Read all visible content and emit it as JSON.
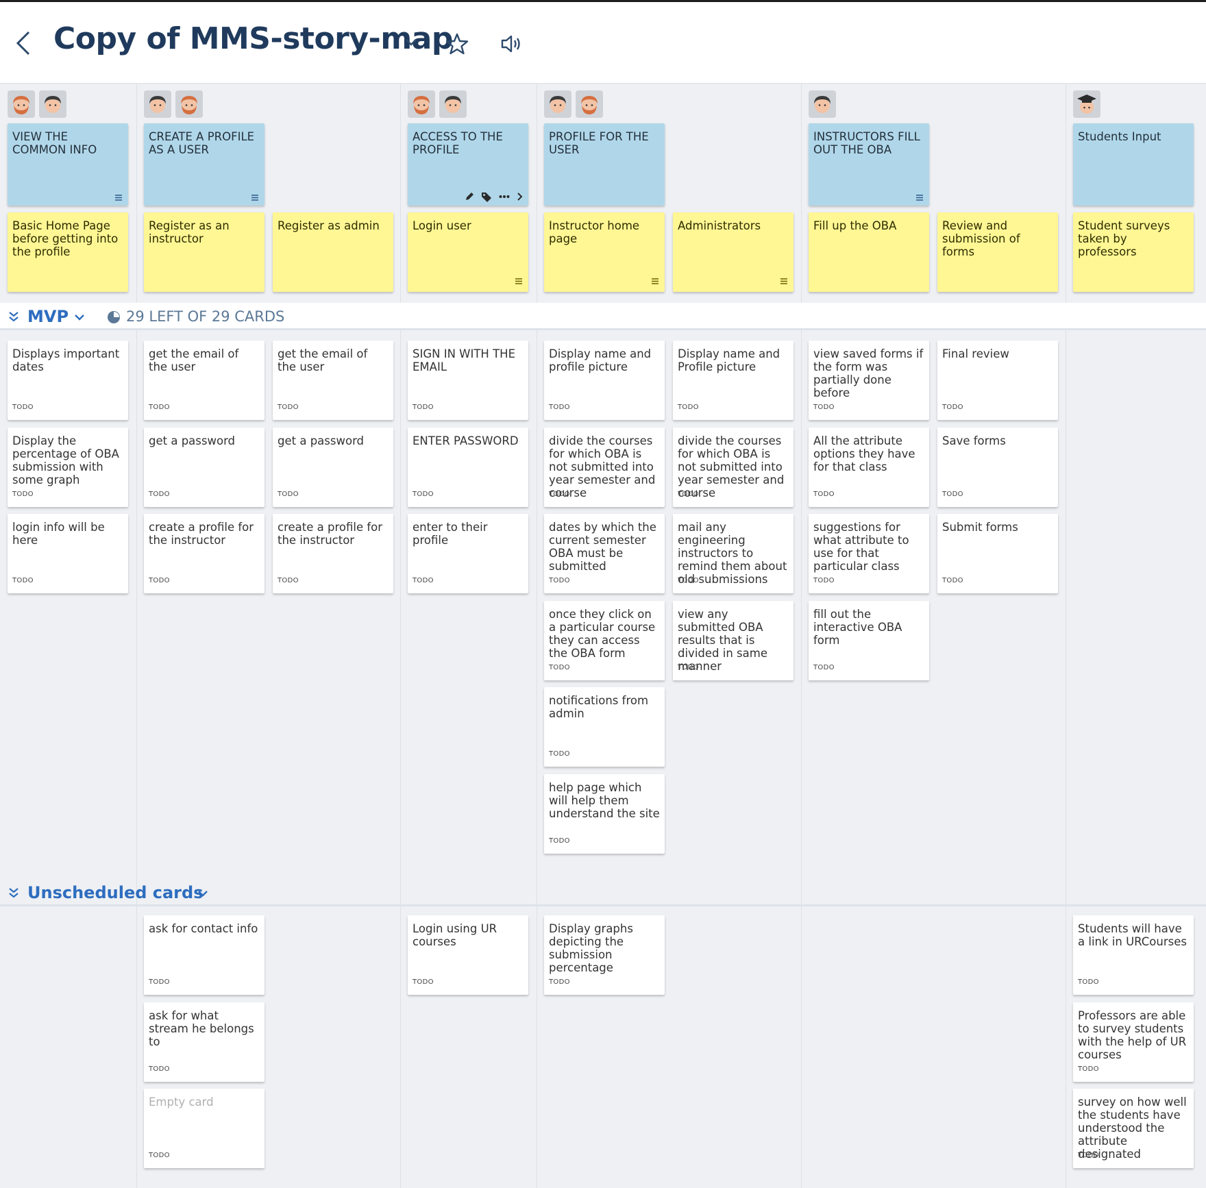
{
  "header": {
    "title": "Copy of MMS-story-map"
  },
  "avatars": {
    "redbeard": "#d56f40",
    "dark": "#3a3a3a"
  },
  "epics": [
    {
      "label": "VIEW THE COMMON INFO"
    },
    {
      "label": "CREATE A PROFILE AS A USER"
    },
    {
      "label": "ACCESS TO THE PROFILE"
    },
    {
      "label": "PROFILE FOR THE USER"
    },
    {
      "label": "INSTRUCTORS FILL OUT THE OBA"
    },
    {
      "label": "Students Input"
    }
  ],
  "activities": [
    {
      "label": "Basic Home Page before getting into the profile"
    },
    {
      "label": "Register as an instructor"
    },
    {
      "label": "Register as admin"
    },
    {
      "label": "Login user"
    },
    {
      "label": "Instructor home page"
    },
    {
      "label": "Administrators"
    },
    {
      "label": "Fill up the OBA"
    },
    {
      "label": "Review and submission of forms"
    },
    {
      "label": "Student surveys taken by professors"
    }
  ],
  "releases": {
    "mvp": {
      "title": "MVP",
      "count": "29 LEFT OF 29 CARDS"
    },
    "unscheduled": {
      "title": "Unscheduled cards"
    }
  },
  "status": "TODO",
  "mvp_columns": [
    [
      "Displays important dates",
      "Display the percentage of OBA submission with some graph",
      "login info will be here"
    ],
    [
      "get the email of the user",
      "get a password",
      "create a profile for the instructor"
    ],
    [
      "get the email of the user",
      "get a password",
      "create a profile for the instructor"
    ],
    [
      "SIGN IN WITH THE EMAIL",
      "ENTER PASSWORD",
      "enter to their profile"
    ],
    [
      "Display name and profile picture",
      "divide the courses for which OBA is not submitted into year semester and course",
      "dates by which the current semester OBA must be submitted",
      "once they click on a particular course they can access the OBA form",
      "notifications from admin",
      "help page which will help them understand the site"
    ],
    [
      "Display name and Profile picture",
      "divide the courses for which OBA is not submitted into year semester and course",
      "mail any engineering instructors to remind them about old submissions",
      "view any submitted OBA results that is divided in same manner"
    ],
    [
      "view saved forms if the form was partially done before",
      "All the attribute options they have for that class",
      "suggestions for what attribute to use for that particular class",
      "fill out the interactive OBA form"
    ],
    [
      "Final review",
      "Save forms",
      "Submit forms"
    ],
    []
  ],
  "unscheduled_columns": [
    [],
    [
      "ask for contact info",
      "ask for what stream he belongs to",
      "Empty card"
    ],
    [],
    [
      "Login using UR courses"
    ],
    [
      "Display graphs depicting the submission percentage"
    ],
    [],
    [],
    [],
    [
      "Students will have a link in URCourses",
      "Professors are able to survey students with the help of UR courses",
      "survey on how well the students have understood the attribute designated"
    ]
  ]
}
